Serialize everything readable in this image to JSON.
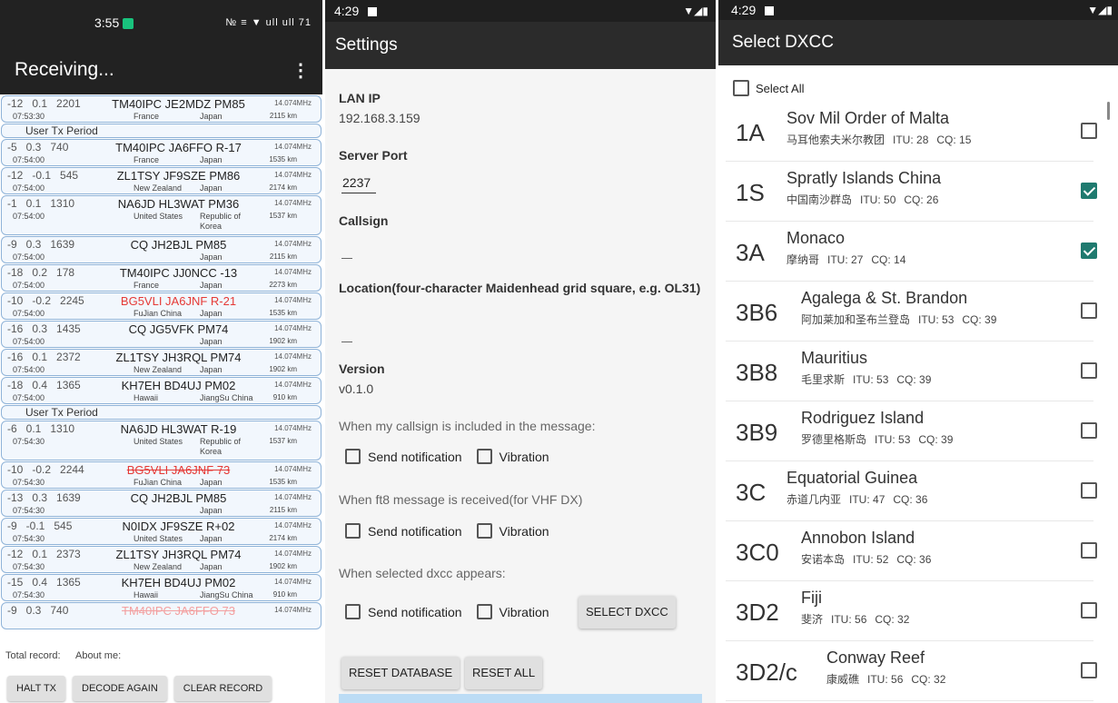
{
  "p1": {
    "time": "3:55",
    "status_icons": "№ ≡ ▼ ull ull 71",
    "title": "Receiving...",
    "rows": [
      {
        "kind": "std",
        "snr": "-12",
        "dt": "0.1",
        "df": "2201",
        "msg": "TM40IPC JE2MDZ PM85",
        "style": "",
        "freq": "14.074MHz",
        "time": "07:53:30",
        "c1": "France",
        "c2": "Japan",
        "dist": "2115 km"
      },
      {
        "kind": "period",
        "text": "User Tx Period"
      },
      {
        "kind": "std",
        "snr": "-5",
        "dt": "0.3",
        "df": "740",
        "msg": "TM40IPC JA6FFO R-17",
        "style": "",
        "freq": "14.074MHz",
        "time": "07:54:00",
        "c1": "France",
        "c2": "Japan",
        "dist": "1535 km"
      },
      {
        "kind": "std",
        "snr": "-12",
        "dt": "-0.1",
        "df": "545",
        "msg": "ZL1TSY JF9SZE PM86",
        "style": "",
        "freq": "14.074MHz",
        "time": "07:54:00",
        "c1": "New Zealand",
        "c2": "Japan",
        "dist": "2174 km"
      },
      {
        "kind": "h3",
        "snr": "-1",
        "dt": "0.1",
        "df": "1310",
        "msg": "NA6JD HL3WAT PM36",
        "style": "",
        "freq": "14.074MHz",
        "time": "07:54:00",
        "c1": "United States",
        "c2": "Republic of Korea",
        "dist": "1537 km"
      },
      {
        "kind": "std",
        "snr": "-9",
        "dt": "0.3",
        "df": "1639",
        "msg": "CQ JH2BJL PM85",
        "style": "",
        "freq": "14.074MHz",
        "time": "07:54:00",
        "c1": "",
        "c2": "Japan",
        "dist": "2115 km"
      },
      {
        "kind": "std",
        "snr": "-18",
        "dt": "0.2",
        "df": "178",
        "msg": "TM40IPC JJ0NCC -13",
        "style": "",
        "freq": "14.074MHz",
        "time": "07:54:00",
        "c1": "France",
        "c2": "Japan",
        "dist": "2273 km"
      },
      {
        "kind": "std",
        "snr": "-10",
        "dt": "-0.2",
        "df": "2245",
        "msg": "BG5VLI JA6JNF R-21",
        "style": "red",
        "freq": "14.074MHz",
        "time": "07:54:00",
        "c1": "FuJian China",
        "c2": "Japan",
        "dist": "1535 km"
      },
      {
        "kind": "std",
        "snr": "-16",
        "dt": "0.3",
        "df": "1435",
        "msg": "CQ JG5VFK PM74",
        "style": "",
        "freq": "14.074MHz",
        "time": "07:54:00",
        "c1": "",
        "c2": "Japan",
        "dist": "1902 km"
      },
      {
        "kind": "std",
        "snr": "-16",
        "dt": "0.1",
        "df": "2372",
        "msg": "ZL1TSY JH3RQL PM74",
        "style": "",
        "freq": "14.074MHz",
        "time": "07:54:00",
        "c1": "New Zealand",
        "c2": "Japan",
        "dist": "1902 km"
      },
      {
        "kind": "std",
        "snr": "-18",
        "dt": "0.4",
        "df": "1365",
        "msg": "KH7EH BD4UJ PM02",
        "style": "",
        "freq": "14.074MHz",
        "time": "07:54:00",
        "c1": "Hawaii",
        "c2": "JiangSu China",
        "dist": "910 km"
      },
      {
        "kind": "period",
        "text": "User Tx Period"
      },
      {
        "kind": "h3",
        "snr": "-6",
        "dt": "0.1",
        "df": "1310",
        "msg": "NA6JD HL3WAT R-19",
        "style": "",
        "freq": "14.074MHz",
        "time": "07:54:30",
        "c1": "United States",
        "c2": "Republic of Korea",
        "dist": "1537 km"
      },
      {
        "kind": "std",
        "snr": "-10",
        "dt": "-0.2",
        "df": "2244",
        "msg": "BG5VLI JA6JNF 73",
        "style": "strike",
        "freq": "14.074MHz",
        "time": "07:54:30",
        "c1": "FuJian China",
        "c2": "Japan",
        "dist": "1535 km"
      },
      {
        "kind": "std",
        "snr": "-13",
        "dt": "0.3",
        "df": "1639",
        "msg": "CQ JH2BJL PM85",
        "style": "",
        "freq": "14.074MHz",
        "time": "07:54:30",
        "c1": "",
        "c2": "Japan",
        "dist": "2115 km"
      },
      {
        "kind": "std",
        "snr": "-9",
        "dt": "-0.1",
        "df": "545",
        "msg": "N0IDX JF9SZE R+02",
        "style": "",
        "freq": "14.074MHz",
        "time": "07:54:30",
        "c1": "United States",
        "c2": "Japan",
        "dist": "2174 km"
      },
      {
        "kind": "std",
        "snr": "-12",
        "dt": "0.1",
        "df": "2373",
        "msg": "ZL1TSY JH3RQL PM74",
        "style": "",
        "freq": "14.074MHz",
        "time": "07:54:30",
        "c1": "New Zealand",
        "c2": "Japan",
        "dist": "1902 km"
      },
      {
        "kind": "std",
        "snr": "-15",
        "dt": "0.4",
        "df": "1365",
        "msg": "KH7EH BD4UJ PM02",
        "style": "",
        "freq": "14.074MHz",
        "time": "07:54:30",
        "c1": "Hawaii",
        "c2": "JiangSu China",
        "dist": "910 km"
      },
      {
        "kind": "std",
        "snr": "-9",
        "dt": "0.3",
        "df": "740",
        "msg": "TM40IPC JA6FFO 73",
        "style": "strikelight",
        "freq": "14.074MHz",
        "time": "",
        "c1": "",
        "c2": "",
        "dist": ""
      }
    ],
    "total_record": "Total record:",
    "about_me": "About me:",
    "halt_tx": "HALT TX",
    "decode_again": "DECODE AGAIN",
    "clear_record": "CLEAR RECORD"
  },
  "p2": {
    "time": "4:29",
    "title": "Settings",
    "lan_ip_label": "LAN IP",
    "lan_ip": "192.168.3.159",
    "server_port_label": "Server Port",
    "server_port": "2237",
    "callsign_label": "Callsign",
    "location_label": "Location(four-character Maidenhead grid square, e.g. OL31)",
    "version_label": "Version",
    "version": "v0.1.0",
    "hint1": "When my callsign is included in the message:",
    "hint2": "When ft8 message is received(for VHF DX)",
    "hint3": "When selected dxcc appears:",
    "send_notification": "Send notification",
    "vibration": "Vibration",
    "select_dxcc": "SELECT DXCC",
    "reset_database": "RESET DATABASE",
    "reset_all": "RESET ALL"
  },
  "p3": {
    "time": "4:29",
    "title": "Select DXCC",
    "select_all": "Select All",
    "items": [
      {
        "code": "1A",
        "name": "Sov Mil Order of Malta",
        "cn": "马耳他索夫米尔教团",
        "itu": "ITU: 28",
        "cq": "CQ: 15",
        "checked": false
      },
      {
        "code": "1S",
        "name": "Spratly Islands China",
        "cn": "中国南沙群岛",
        "itu": "ITU: 50",
        "cq": "CQ: 26",
        "checked": true
      },
      {
        "code": "3A",
        "name": "Monaco",
        "cn": "摩纳哥",
        "itu": "ITU: 27",
        "cq": "CQ: 14",
        "checked": true
      },
      {
        "code": "3B6",
        "name": "Agalega & St. Brandon",
        "cn": "阿加莱加和圣布兰登岛",
        "itu": "ITU: 53",
        "cq": "CQ: 39",
        "checked": false
      },
      {
        "code": "3B8",
        "name": "Mauritius",
        "cn": "毛里求斯",
        "itu": "ITU: 53",
        "cq": "CQ: 39",
        "checked": false
      },
      {
        "code": "3B9",
        "name": "Rodriguez Island",
        "cn": "罗德里格斯岛",
        "itu": "ITU: 53",
        "cq": "CQ: 39",
        "checked": false
      },
      {
        "code": "3C",
        "name": "Equatorial Guinea",
        "cn": "赤道几内亚",
        "itu": "ITU: 47",
        "cq": "CQ: 36",
        "checked": false
      },
      {
        "code": "3C0",
        "name": "Annobon Island",
        "cn": "安诺本岛",
        "itu": "ITU: 52",
        "cq": "CQ: 36",
        "checked": false
      },
      {
        "code": "3D2",
        "name": "Fiji",
        "cn": "斐济",
        "itu": "ITU: 56",
        "cq": "CQ: 32",
        "checked": false
      },
      {
        "code": "3D2/c",
        "name": "Conway Reef",
        "cn": "康威礁",
        "itu": "ITU: 56",
        "cq": "CQ: 32",
        "checked": false
      }
    ]
  }
}
